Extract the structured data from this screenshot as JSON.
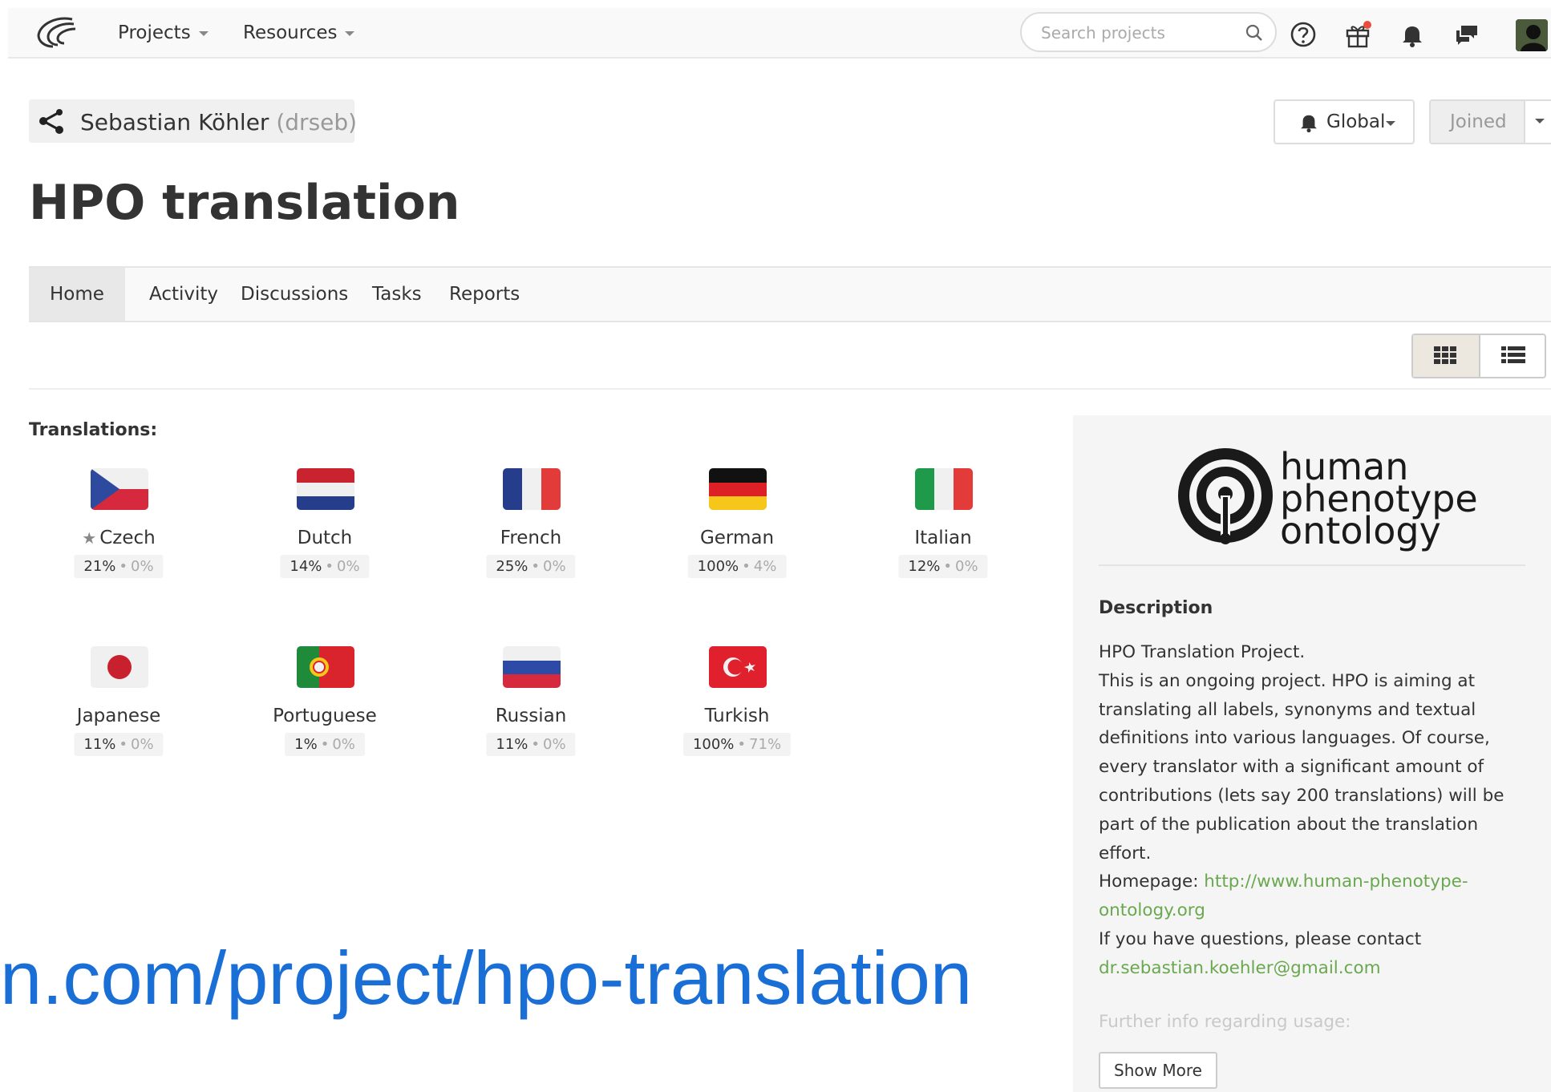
{
  "navbar": {
    "projects_label": "Projects",
    "resources_label": "Resources",
    "search_placeholder": "Search projects"
  },
  "project": {
    "owner_name": "Sebastian Köhler",
    "owner_handle": "(drseb)",
    "title": "HPO translation",
    "global_label": "Global",
    "joined_label": "Joined"
  },
  "tabs": [
    {
      "label": "Home",
      "active": true
    },
    {
      "label": "Activity"
    },
    {
      "label": "Discussions"
    },
    {
      "label": "Tasks"
    },
    {
      "label": "Reports"
    }
  ],
  "translations_label": "Translations:",
  "languages": [
    {
      "name": "Czech",
      "starred": true,
      "translated": "21%",
      "approved": "0%"
    },
    {
      "name": "Dutch",
      "translated": "14%",
      "approved": "0%"
    },
    {
      "name": "French",
      "translated": "25%",
      "approved": "0%"
    },
    {
      "name": "German",
      "translated": "100%",
      "approved": "4%"
    },
    {
      "name": "Italian",
      "translated": "12%",
      "approved": "0%"
    },
    {
      "name": "Japanese",
      "translated": "11%",
      "approved": "0%"
    },
    {
      "name": "Portuguese",
      "translated": "1%",
      "approved": "0%"
    },
    {
      "name": "Russian",
      "translated": "11%",
      "approved": "0%"
    },
    {
      "name": "Turkish",
      "translated": "100%",
      "approved": "71%"
    }
  ],
  "url_overlay": "n.com/project/hpo-translation",
  "side": {
    "logo_line1": "human",
    "logo_line2": "phenotype",
    "logo_line3": "ontology",
    "description_heading": "Description",
    "line_intro": "HPO Translation Project.",
    "line_body": "This is an ongoing project. HPO is aiming at translating all labels, synonyms and textual definitions into various languages. Of course, every translator with a significant amount of contributions (lets say 200 translations) will be part of the publication about the translation effort.",
    "homepage_label": "Homepage:",
    "homepage_url": "http://www.human-phenotype-ontology.org",
    "contact_text": "If you have questions, please contact",
    "contact_email": "dr.sebastian.koehler@gmail.com",
    "further_info": "Further info regarding usage:",
    "show_more": "Show More"
  },
  "colors": {
    "link_green": "#6aa84f",
    "url_blue": "#1a6fd6",
    "notification_dot": "#e84c3d"
  }
}
